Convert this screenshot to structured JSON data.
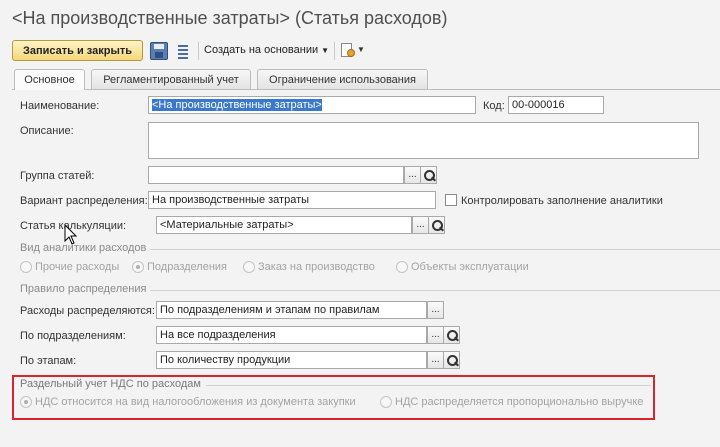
{
  "window": {
    "title": "<На производственные затраты> (Статья расходов)"
  },
  "toolbar": {
    "save_close_label": "Записать и закрыть",
    "create_based_label": "Создать на основании",
    "save_icon": "floppy-disk-icon",
    "list_icon": "list-icon",
    "doc_icon": "document-chart-icon"
  },
  "tabs": [
    {
      "label": "Основное",
      "active": true
    },
    {
      "label": "Регламентированный учет",
      "active": false
    },
    {
      "label": "Ограничение использования",
      "active": false
    }
  ],
  "form": {
    "name_label": "Наименование:",
    "name_value": "<На производственные затраты>",
    "code_label": "Код:",
    "code_value": "00-000016",
    "description_label": "Описание:",
    "description_value": "",
    "group_label": "Группа статей:",
    "group_value": "",
    "distribution_variant_label": "Вариант распределения:",
    "distribution_variant_value": "На производственные затраты",
    "control_analytics_label": "Контролировать заполнение аналитики",
    "calc_item_label": "Статья калькуляции:",
    "calc_item_value": "<Материальные затраты>"
  },
  "analytics_section": {
    "title": "Вид аналитики расходов",
    "options": [
      {
        "label": "Прочие расходы",
        "selected": false
      },
      {
        "label": "Подразделения",
        "selected": true
      },
      {
        "label": "Заказ на производство",
        "selected": false
      },
      {
        "label": "Объекты эксплуатации",
        "selected": false
      }
    ]
  },
  "distribution_rule": {
    "title": "Правило распределения",
    "expenses_label": "Расходы распределяются:",
    "expenses_value": "По подразделениям и этапам по правилам",
    "by_depts_label": "По подразделениям:",
    "by_depts_value": "На все подразделения",
    "by_stages_label": "По этапам:",
    "by_stages_value": "По количеству продукции"
  },
  "vat_section": {
    "title": "Раздельный учет НДС по расходам",
    "options": [
      {
        "label": "НДС относится на вид налогообложения из документа закупки",
        "selected": true
      },
      {
        "label": "НДС распределяется пропорционально выручке",
        "selected": false
      }
    ]
  },
  "colors": {
    "accent_button": "#f5d77a",
    "highlight_border": "#d9262c",
    "selection": "#3a78c9"
  }
}
